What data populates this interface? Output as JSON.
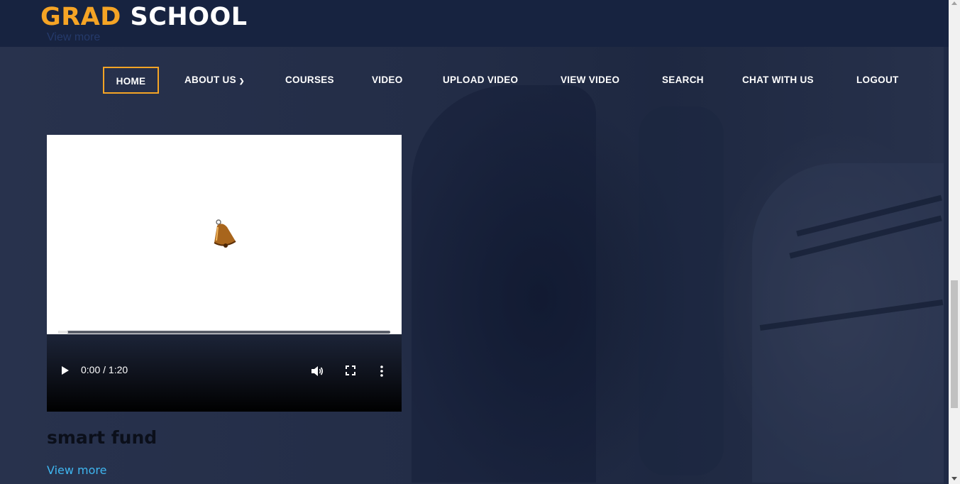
{
  "brand": {
    "part1": "GRAD",
    "part2": "SCHOOL"
  },
  "ghost_link": "View more",
  "nav": {
    "items": [
      {
        "label": "HOME"
      },
      {
        "label": "ABOUT US"
      },
      {
        "label": "COURSES"
      },
      {
        "label": "VIDEO"
      },
      {
        "label": "UPLOAD VIDEO"
      },
      {
        "label": "VIEW VIDEO"
      },
      {
        "label": "SEARCH"
      },
      {
        "label": "CHAT WITH US"
      },
      {
        "label": "LOGOUT"
      }
    ]
  },
  "video": {
    "time_display": "0:00 / 1:20",
    "progress_fraction": 0.0
  },
  "card": {
    "title": "smart fund",
    "link": "View more"
  },
  "colors": {
    "accent": "#f5a425",
    "header_bg": "#172340",
    "link": "#3fb6f0"
  }
}
